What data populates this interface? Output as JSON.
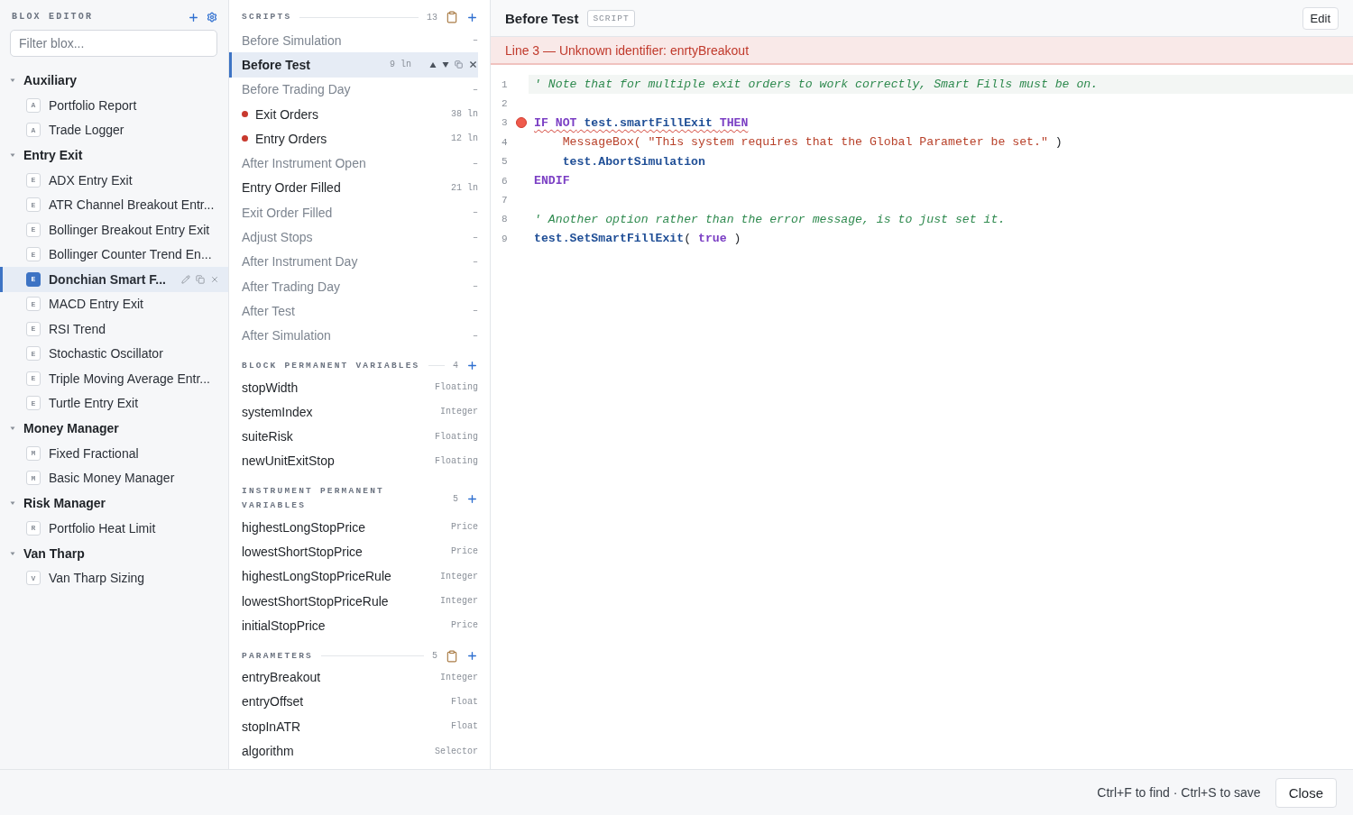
{
  "sidebar": {
    "title": "BLOX EDITOR",
    "filter": {
      "placeholder": "Filter blox..."
    },
    "groups": [
      {
        "name": "Auxiliary",
        "expanded": true,
        "items": [
          {
            "badge": "A",
            "name": "Portfolio Report",
            "selected": false
          },
          {
            "badge": "A",
            "name": "Trade Logger",
            "selected": false
          }
        ]
      },
      {
        "name": "Entry Exit",
        "expanded": true,
        "items": [
          {
            "badge": "E",
            "name": "ADX Entry Exit",
            "selected": false
          },
          {
            "badge": "E",
            "name": "ATR Channel Breakout Entr...",
            "selected": false
          },
          {
            "badge": "E",
            "name": "Bollinger Breakout Entry Exit",
            "selected": false
          },
          {
            "badge": "E",
            "name": "Bollinger Counter Trend En...",
            "selected": false
          },
          {
            "badge": "E",
            "name": "Donchian Smart F...",
            "selected": true
          },
          {
            "badge": "E",
            "name": "MACD Entry Exit",
            "selected": false
          },
          {
            "badge": "E",
            "name": "RSI Trend",
            "selected": false
          },
          {
            "badge": "E",
            "name": "Stochastic Oscillator",
            "selected": false
          },
          {
            "badge": "E",
            "name": "Triple Moving Average Entr...",
            "selected": false
          },
          {
            "badge": "E",
            "name": "Turtle Entry Exit",
            "selected": false
          }
        ]
      },
      {
        "name": "Money Manager",
        "expanded": true,
        "items": [
          {
            "badge": "M",
            "name": "Fixed Fractional",
            "selected": false
          },
          {
            "badge": "M",
            "name": "Basic Money Manager",
            "selected": false
          }
        ]
      },
      {
        "name": "Risk Manager",
        "expanded": true,
        "items": [
          {
            "badge": "R",
            "name": "Portfolio Heat Limit",
            "selected": false
          }
        ]
      },
      {
        "name": "Van Tharp",
        "expanded": true,
        "items": [
          {
            "badge": "V",
            "name": "Van Tharp Sizing",
            "selected": false
          }
        ]
      }
    ]
  },
  "scripts_panel": {
    "sections": [
      {
        "kind": "scripts",
        "title": "SCRIPTS",
        "count": "13",
        "clipboard": true,
        "items": [
          {
            "name": "Before Simulation",
            "lines": "–",
            "empty": true,
            "error": false,
            "selected": false
          },
          {
            "name": "Before Test",
            "lines": "9 ln",
            "empty": false,
            "error": false,
            "selected": true
          },
          {
            "name": "Before Trading Day",
            "lines": "–",
            "empty": true,
            "error": false,
            "selected": false
          },
          {
            "name": "Exit Orders",
            "lines": "38 ln",
            "empty": false,
            "error": true,
            "selected": false
          },
          {
            "name": "Entry Orders",
            "lines": "12 ln",
            "empty": false,
            "error": true,
            "selected": false
          },
          {
            "name": "After Instrument Open",
            "lines": "–",
            "empty": true,
            "error": false,
            "selected": false
          },
          {
            "name": "Entry Order Filled",
            "lines": "21 ln",
            "empty": false,
            "error": false,
            "selected": false
          },
          {
            "name": "Exit Order Filled",
            "lines": "–",
            "empty": true,
            "error": false,
            "selected": false
          },
          {
            "name": "Adjust Stops",
            "lines": "–",
            "empty": true,
            "error": false,
            "selected": false
          },
          {
            "name": "After Instrument Day",
            "lines": "–",
            "empty": true,
            "error": false,
            "selected": false
          },
          {
            "name": "After Trading Day",
            "lines": "–",
            "empty": true,
            "error": false,
            "selected": false
          },
          {
            "name": "After Test",
            "lines": "–",
            "empty": true,
            "error": false,
            "selected": false
          },
          {
            "name": "After Simulation",
            "lines": "–",
            "empty": true,
            "error": false,
            "selected": false
          }
        ]
      },
      {
        "kind": "variables",
        "title": "BLOCK PERMANENT VARIABLES",
        "count": "4",
        "clipboard": false,
        "items": [
          {
            "name": "stopWidth",
            "type": "Floating"
          },
          {
            "name": "systemIndex",
            "type": "Integer"
          },
          {
            "name": "suiteRisk",
            "type": "Floating"
          },
          {
            "name": "newUnitExitStop",
            "type": "Floating"
          }
        ]
      },
      {
        "kind": "variables",
        "title": "INSTRUMENT PERMANENT VARIABLES",
        "count": "5",
        "clipboard": false,
        "items": [
          {
            "name": "highestLongStopPrice",
            "type": "Price"
          },
          {
            "name": "lowestShortStopPrice",
            "type": "Price"
          },
          {
            "name": "highestLongStopPriceRule",
            "type": "Integer"
          },
          {
            "name": "lowestShortStopPriceRule",
            "type": "Integer"
          },
          {
            "name": "initialStopPrice",
            "type": "Price"
          }
        ]
      },
      {
        "kind": "variables",
        "title": "PARAMETERS",
        "count": "5",
        "clipboard": true,
        "items": [
          {
            "name": "entryBreakout",
            "type": "Integer"
          },
          {
            "name": "entryOffset",
            "type": "Float"
          },
          {
            "name": "stopInATR",
            "type": "Float"
          },
          {
            "name": "algorithm",
            "type": "Selector"
          }
        ]
      }
    ]
  },
  "editor": {
    "title": "Before Test",
    "badge": "SCRIPT",
    "edit_button": "Edit",
    "error_banner": "Line 3 — Unknown identifier: enrtyBreakout",
    "lines": [
      {
        "number": "1",
        "current": true,
        "error": false,
        "tokens": [
          {
            "kind": "comment",
            "text": "' Note that for multiple exit orders to work correctly, Smart Fills must be on."
          }
        ]
      },
      {
        "number": "2",
        "current": false,
        "error": false
      },
      {
        "number": "3",
        "current": false,
        "error": true,
        "tokens": [
          {
            "kind": "keyword",
            "text": "IF NOT"
          },
          {
            "kind": "ident",
            "text": " test.smartFillExit "
          },
          {
            "kind": "keyword",
            "text": "THEN"
          }
        ]
      },
      {
        "number": "4",
        "current": false,
        "error": false,
        "tokens": [
          {
            "kind": "call",
            "text": "    MessageBox( \"This system requires that the Global Parameter be set.\""
          },
          {
            "kind": "plain",
            "text": " )"
          }
        ]
      },
      {
        "number": "5",
        "current": false,
        "error": false,
        "tokens": [
          {
            "kind": "ident",
            "text": "    test.AbortSimulation"
          }
        ]
      },
      {
        "number": "6",
        "current": false,
        "error": false,
        "tokens": [
          {
            "kind": "keyword",
            "text": "ENDIF"
          }
        ]
      },
      {
        "number": "7",
        "current": false,
        "error": false
      },
      {
        "number": "8",
        "current": false,
        "error": false,
        "tokens": [
          {
            "kind": "comment",
            "text": "' Another option rather than the error message, is to just set it."
          }
        ]
      },
      {
        "number": "9",
        "current": false,
        "error": false,
        "tokens": [
          {
            "kind": "ident",
            "text": "test.SetSmartFillExit"
          },
          {
            "kind": "plain",
            "text": "( "
          },
          {
            "kind": "keyword",
            "text": "true"
          },
          {
            "kind": "plain",
            "text": " )"
          }
        ]
      }
    ]
  },
  "footer": {
    "hint": "Ctrl+F to find · Ctrl+S to save",
    "close_button": "Close"
  }
}
